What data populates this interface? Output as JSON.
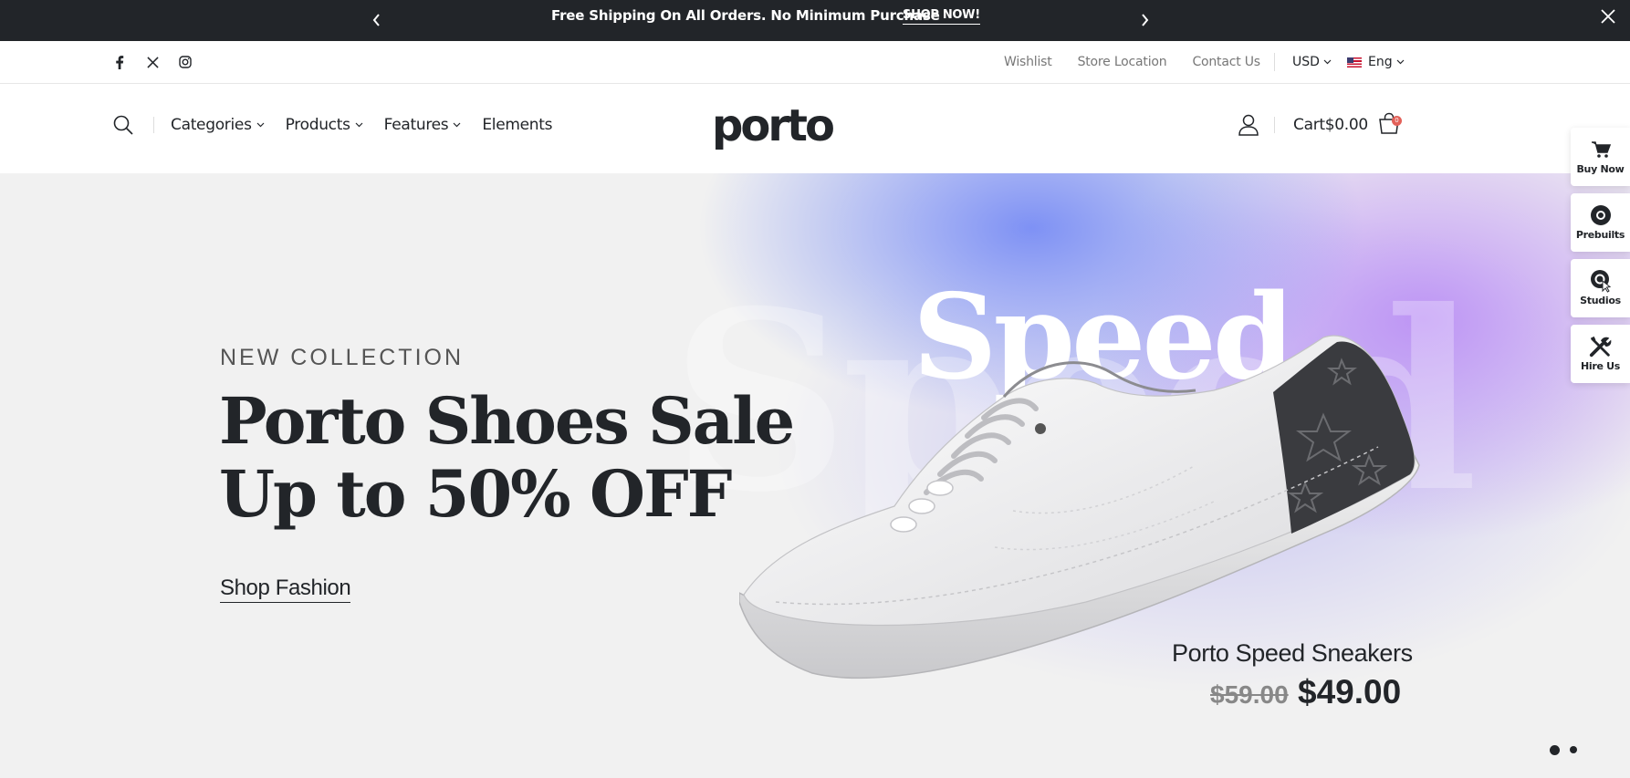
{
  "promo": {
    "message": "Free Shipping On All Orders. No Minimum Purchase",
    "shop_link": "SHOP NOW!"
  },
  "topbar": {
    "social": [
      "facebook-icon",
      "x-twitter-icon",
      "instagram-icon"
    ],
    "links": [
      "Wishlist",
      "Store Location",
      "Contact Us"
    ],
    "currency": "USD",
    "language": "Eng"
  },
  "header": {
    "nav": [
      "Categories",
      "Products",
      "Features",
      "Elements"
    ],
    "logo": "porto",
    "cart_label": "Cart",
    "cart_total": "$0.00",
    "cart_count": "0"
  },
  "hero": {
    "bg_word": "Speed",
    "overlay_word": "Speed",
    "kicker": "NEW COLLECTION",
    "headline_line1": "Porto Shoes Sale",
    "headline_line2": "Up to 50% OFF",
    "cta": "Shop Fashion",
    "product_name": "Porto Speed Sneakers",
    "old_price": "$59.00",
    "new_price": "$49.00",
    "slides_count": 2,
    "active_slide": 1
  },
  "float_panel": [
    {
      "label": "Buy Now",
      "icon": "cart-icon"
    },
    {
      "label": "Prebuilts",
      "icon": "disc-icon"
    },
    {
      "label": "Studios",
      "icon": "pin-cursor-icon"
    },
    {
      "label": "Hire Us",
      "icon": "tools-icon"
    }
  ],
  "colors": {
    "dark": "#222529",
    "muted": "#777777",
    "badge": "#e36159",
    "hero_blue": "#788cf5",
    "hero_purple": "#b98cf5"
  }
}
